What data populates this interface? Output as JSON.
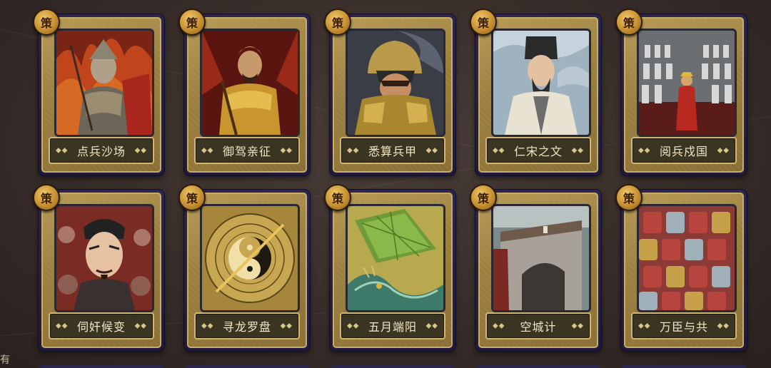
{
  "badge_label": "策",
  "edge_text": "有",
  "cards": [
    {
      "name": "点兵沙场",
      "portrait": "armored-general-fire"
    },
    {
      "name": "御驾亲征",
      "portrait": "emperor-in-armor"
    },
    {
      "name": "悉算兵甲",
      "portrait": "helmeted-warrior"
    },
    {
      "name": "仁宋之文",
      "portrait": "scholar-official"
    },
    {
      "name": "阅兵戍国",
      "portrait": "army-review"
    },
    {
      "name": "伺奸候变",
      "portrait": "minister-portrait"
    },
    {
      "name": "寻龙罗盘",
      "portrait": "yin-yang-compass"
    },
    {
      "name": "五月端阳",
      "portrait": "dragon-zongzi"
    },
    {
      "name": "空城计",
      "portrait": "city-gate"
    },
    {
      "name": "万臣与共",
      "portrait": "court-ministers"
    }
  ],
  "colors": {
    "frame": "#2b2550",
    "gold": "#b79a55",
    "plate": "#3a3523",
    "text": "#f2e6c5"
  }
}
